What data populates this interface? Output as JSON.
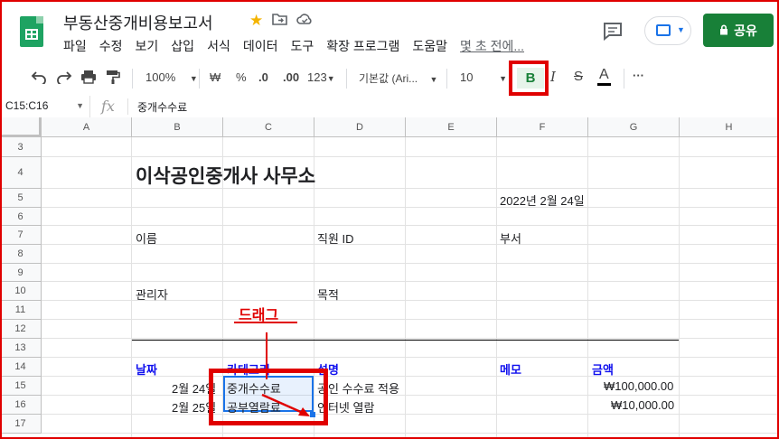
{
  "header": {
    "doc_title": "부동산중개비용보고서",
    "menu": [
      "파일",
      "수정",
      "보기",
      "삽입",
      "서식",
      "데이터",
      "도구",
      "확장 프로그램",
      "도움말"
    ],
    "last_edit": "몇 초 전에...",
    "share_label": "공유"
  },
  "toolbar": {
    "zoom": "100%",
    "currency": "₩",
    "percent": "%",
    "dec_decrease": ".0",
    "dec_increase": ".00",
    "format_more": "123",
    "font": "기본값 (Ari...",
    "font_size": "10",
    "bold": "B",
    "italic": "I",
    "strike": "S",
    "text_color": "A",
    "more": "···"
  },
  "formula_bar": {
    "name_box": "C15:C16",
    "fx": "fx",
    "content": "중개수수료"
  },
  "grid": {
    "columns": [
      "A",
      "B",
      "C",
      "D",
      "E",
      "F",
      "G",
      "H"
    ],
    "rows": [
      "3",
      "4",
      "5",
      "6",
      "7",
      "8",
      "9",
      "10",
      "11",
      "12",
      "13",
      "14",
      "15",
      "16",
      "17"
    ]
  },
  "sheet": {
    "company": "이삭공인중개사 사무소",
    "date": "2022년 2월 24일",
    "name_label": "이름",
    "employee_id_label": "직원 ID",
    "department_label": "부서",
    "manager_label": "관리자",
    "purpose_label": "목적",
    "table_headers": {
      "date": "날짜",
      "category": "카테고리",
      "description": "설명",
      "memo": "메모",
      "amount": "금액"
    },
    "rows": [
      {
        "date": "2월 24일",
        "category": "중개수수료",
        "description": "공인 수수료 적용",
        "amount": "₩100,000.00"
      },
      {
        "date": "2월 25일",
        "category": "공부열람료",
        "description": "인터넷 열람",
        "amount": "₩10,000.00"
      }
    ]
  },
  "annotation": {
    "drag_label": "드래그",
    "color": "#e00000"
  }
}
